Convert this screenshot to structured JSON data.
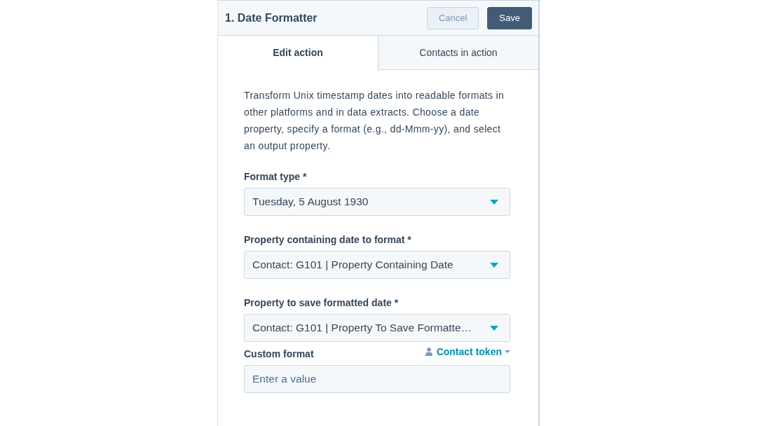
{
  "header": {
    "title": "1. Date Formatter",
    "buttons": [
      {
        "label": "Cancel",
        "kind": "secondary"
      },
      {
        "label": "Save",
        "kind": "primary"
      }
    ]
  },
  "tabs": [
    {
      "label": "Edit action",
      "selected": true
    },
    {
      "label": "Contacts in action",
      "selected": false
    }
  ],
  "description": "Transform Unix timestamp dates into readable formats in other platforms and in data extracts. Choose a date property, specify a format (e.g., dd-Mmm-yy), and select an output property.",
  "fields": [
    {
      "kind": "dropdown",
      "label": "Format type *",
      "value": "Tuesday, 5 August 1930"
    },
    {
      "kind": "dropdown",
      "label": "Property containing date to format *",
      "value": "Contact: G101 | Property Containing Date"
    },
    {
      "kind": "dropdown",
      "label": "Property to save formatted date *",
      "value": "Contact: G101 | Property To Save Formatte…"
    },
    {
      "kind": "text",
      "label": "Custom format",
      "placeholder": "Enter a value",
      "token_link": "Contact token"
    }
  ]
}
